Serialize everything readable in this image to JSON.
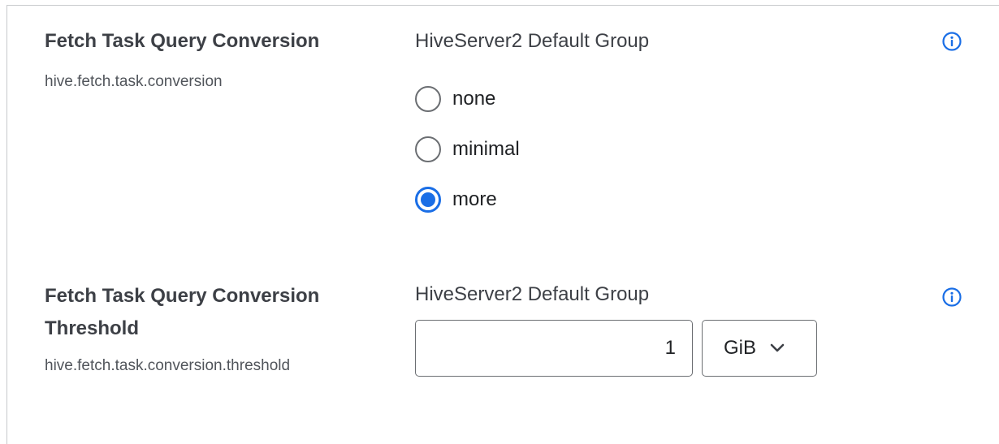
{
  "settings": [
    {
      "display_name": "Fetch Task Query Conversion",
      "property_key": "hive.fetch.task.conversion",
      "group": "HiveServer2 Default Group",
      "options": [
        {
          "label": "none",
          "checked": false
        },
        {
          "label": "minimal",
          "checked": false
        },
        {
          "label": "more",
          "checked": true
        }
      ],
      "info_icon": "info-icon"
    },
    {
      "display_name": "Fetch Task Query Conversion Threshold",
      "property_key": "hive.fetch.task.conversion.threshold",
      "group": "HiveServer2 Default Group",
      "value": "1",
      "unit": "GiB",
      "info_icon": "info-icon"
    }
  ],
  "colors": {
    "accent": "#1a6ee6",
    "text": "#3d4046",
    "border": "#6b6e72"
  }
}
